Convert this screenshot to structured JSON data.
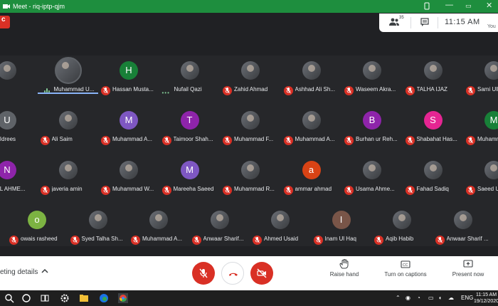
{
  "window": {
    "title": "Meet - riq-iptp-qjm"
  },
  "meeting": {
    "participants_count": "35",
    "time": "11:15 AM",
    "you_label": "You"
  },
  "badge_letter": "c",
  "participants_row1": [
    {
      "name": "u",
      "avatar": "photo",
      "muted": false
    },
    {
      "name": "Muhammad U...",
      "avatar": "photo",
      "muted": false,
      "speaking": true
    },
    {
      "name": "Hassan Musta...",
      "avatar": "H",
      "color": "#188038",
      "muted": true
    },
    {
      "name": "Nufail Qazi",
      "avatar": "photo",
      "muted": false,
      "dots": true
    },
    {
      "name": "Zahid Ahmad",
      "avatar": "photo",
      "muted": true
    },
    {
      "name": "Ashhad Ali Sh...",
      "avatar": "photo",
      "muted": true
    },
    {
      "name": "Waseem Akra...",
      "avatar": "photo",
      "muted": true
    },
    {
      "name": "TALHA IJAZ",
      "avatar": "photo",
      "muted": true
    },
    {
      "name": "Sami Ull",
      "avatar": "photo",
      "muted": true
    }
  ],
  "participants_row2": [
    {
      "name": "ama Idrees",
      "avatar": "U",
      "color": "#5f6368",
      "muted": false
    },
    {
      "name": "Ali Saim",
      "avatar": "photo",
      "muted": true
    },
    {
      "name": "Muhammad A...",
      "avatar": "M",
      "color": "#7e57c2",
      "muted": true
    },
    {
      "name": "Taimoor Shah...",
      "avatar": "T",
      "color": "#8e24aa",
      "muted": true
    },
    {
      "name": "Muhammad F...",
      "avatar": "photo",
      "muted": true
    },
    {
      "name": "Muhammad A...",
      "avatar": "photo",
      "muted": true
    },
    {
      "name": "Burhan ur Reh...",
      "avatar": "B",
      "color": "#8e24aa",
      "muted": true
    },
    {
      "name": "Shabahat Has...",
      "avatar": "S",
      "color": "#e52592",
      "muted": true
    },
    {
      "name": "Muhamm",
      "avatar": "M",
      "color": "#188038",
      "muted": true
    }
  ],
  "participants_row3": [
    {
      "name": "UFAIL AHME...",
      "avatar": "N",
      "color": "#8e24aa",
      "muted": false
    },
    {
      "name": "javeria amin",
      "avatar": "photo",
      "muted": true
    },
    {
      "name": "Muhammad W...",
      "avatar": "photo",
      "muted": true
    },
    {
      "name": "Mareeha Saeed",
      "avatar": "M",
      "color": "#7e57c2",
      "muted": true
    },
    {
      "name": "Muhammad R...",
      "avatar": "photo",
      "muted": true
    },
    {
      "name": "ammar ahmad",
      "avatar": "a",
      "color": "#d84315",
      "muted": true
    },
    {
      "name": "Usama Ahme...",
      "avatar": "photo",
      "muted": true
    },
    {
      "name": "Fahad Sadiq",
      "avatar": "photo",
      "muted": true
    },
    {
      "name": "Saeed U",
      "avatar": "photo",
      "muted": true
    }
  ],
  "participants_row4": [
    {
      "name": "owais rasheed",
      "avatar": "o",
      "color": "#7cb342",
      "muted": true
    },
    {
      "name": "Syed Talha Sh...",
      "avatar": "photo",
      "muted": true
    },
    {
      "name": "Muhammad A...",
      "avatar": "photo",
      "muted": true
    },
    {
      "name": "Anwaar Sharif...",
      "avatar": "photo",
      "muted": true
    },
    {
      "name": "Ahmed Usaid",
      "avatar": "photo",
      "muted": true
    },
    {
      "name": "Inam Ul Haq",
      "avatar": "I",
      "color": "#795548",
      "muted": true
    },
    {
      "name": "Aqib Habib",
      "avatar": "photo",
      "muted": true
    },
    {
      "name": "Anwaar Sharif ...",
      "avatar": "photo",
      "muted": true
    }
  ],
  "controls": {
    "meeting_details": "eting details",
    "raise_hand": "Raise hand",
    "captions": "Turn on captions",
    "present": "Present now"
  },
  "taskbar": {
    "lang": "ENG",
    "time": "11:15 AM",
    "date": "19/12/2020"
  },
  "colors": {
    "accent": "#1e8e3e",
    "danger": "#d93025"
  }
}
